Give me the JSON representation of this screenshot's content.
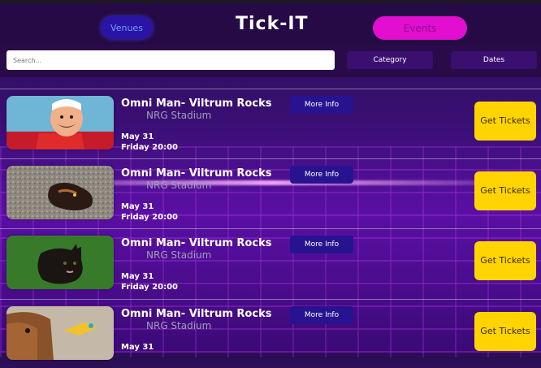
{
  "header": {
    "venues_label": "Venues",
    "title": "Tick-IT",
    "events_label": "Events"
  },
  "filters": {
    "search_placeholder": "Search...",
    "category_label": "Category",
    "dates_label": "Dates"
  },
  "events": [
    {
      "name": "Omni Man- Viltrum Rocks",
      "venue": "NRG Stadium",
      "date": "May 31",
      "time": "Friday 20:00",
      "more_info": "More Info",
      "tickets": "Get Tickets",
      "thumbnail": "cartoon-mustache-man-image"
    },
    {
      "name": "Omni Man- Viltrum Rocks",
      "venue": "NRG Stadium",
      "date": "May 31",
      "time": "Friday 20:00",
      "more_info": "More Info",
      "tickets": "Get Tickets",
      "thumbnail": "tortoiseshell-cat-image"
    },
    {
      "name": "Omni Man- Viltrum Rocks",
      "venue": "NRG Stadium",
      "date": "May 31",
      "time": "Friday 20:00",
      "more_info": "More Info",
      "tickets": "Get Tickets",
      "thumbnail": "black-cat-image"
    },
    {
      "name": "Omni Man- Viltrum Rocks",
      "venue": "NRG Stadium",
      "date": "May 31",
      "time": "",
      "more_info": "More Info",
      "tickets": "Get Tickets",
      "thumbnail": "brown-dog-image"
    }
  ],
  "colors": {
    "accent_yellow": "#ffd400",
    "events_pink": "#e30fd0",
    "venues_blue": "#2a14a6",
    "background_purple": "#3a0f74"
  }
}
